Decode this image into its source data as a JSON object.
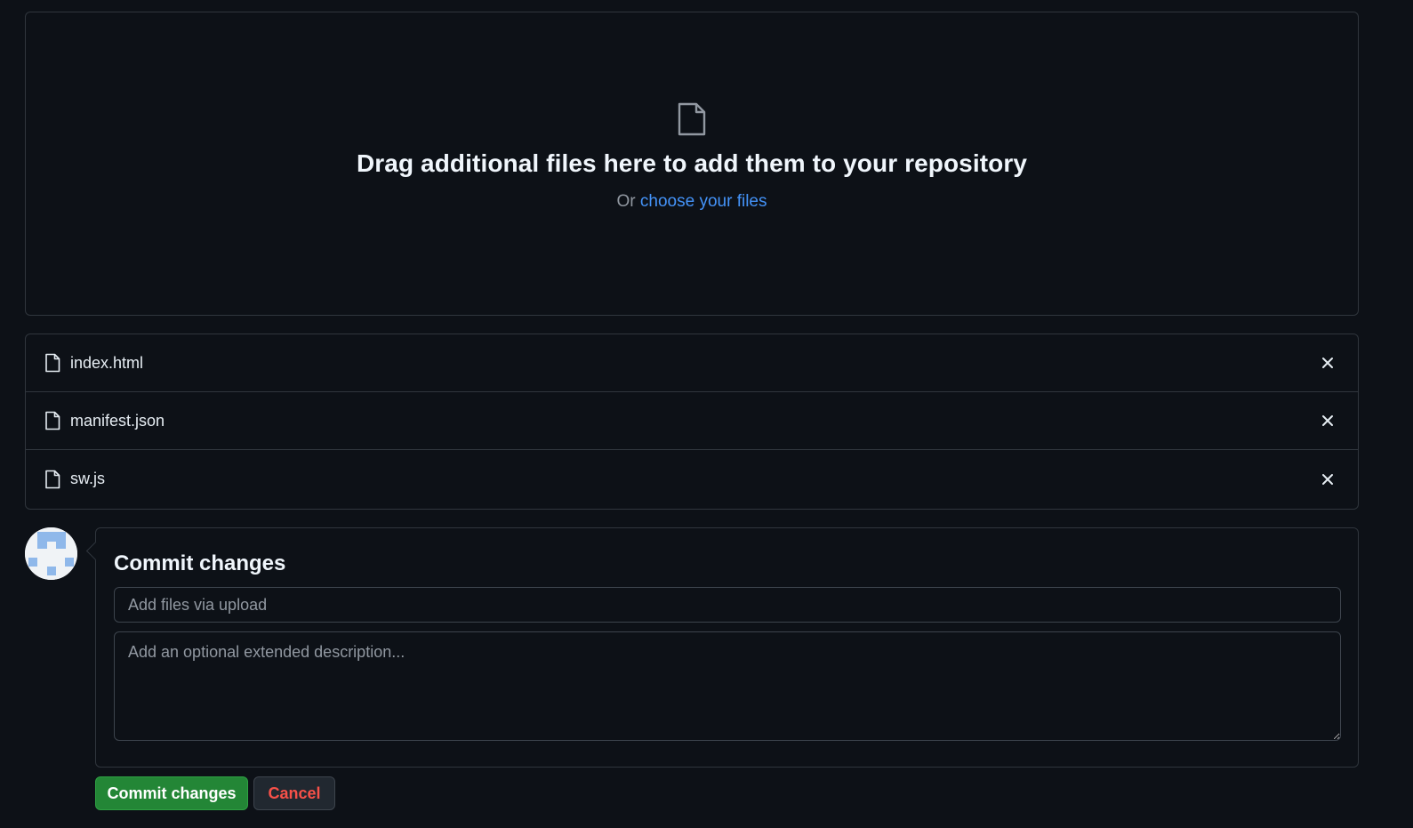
{
  "dropzone": {
    "heading": "Drag additional files here to add them to your repository",
    "or_text": "Or",
    "choose_link": "choose your files",
    "icon": "file-icon"
  },
  "files": [
    {
      "name": "index.html",
      "icon": "file-icon",
      "remove_icon": "x-icon"
    },
    {
      "name": "manifest.json",
      "icon": "file-icon",
      "remove_icon": "x-icon"
    },
    {
      "name": "sw.js",
      "icon": "file-icon",
      "remove_icon": "x-icon"
    }
  ],
  "commit": {
    "heading": "Commit changes",
    "title_placeholder": "Add files via upload",
    "title_value": "",
    "description_placeholder": "Add an optional extended description...",
    "description_value": ""
  },
  "buttons": {
    "commit_label": "Commit changes",
    "cancel_label": "Cancel"
  },
  "colors": {
    "background": "#0d1117",
    "border": "#30363d",
    "link": "#4493f8",
    "primary_button": "#238636",
    "danger_text": "#f85149"
  }
}
